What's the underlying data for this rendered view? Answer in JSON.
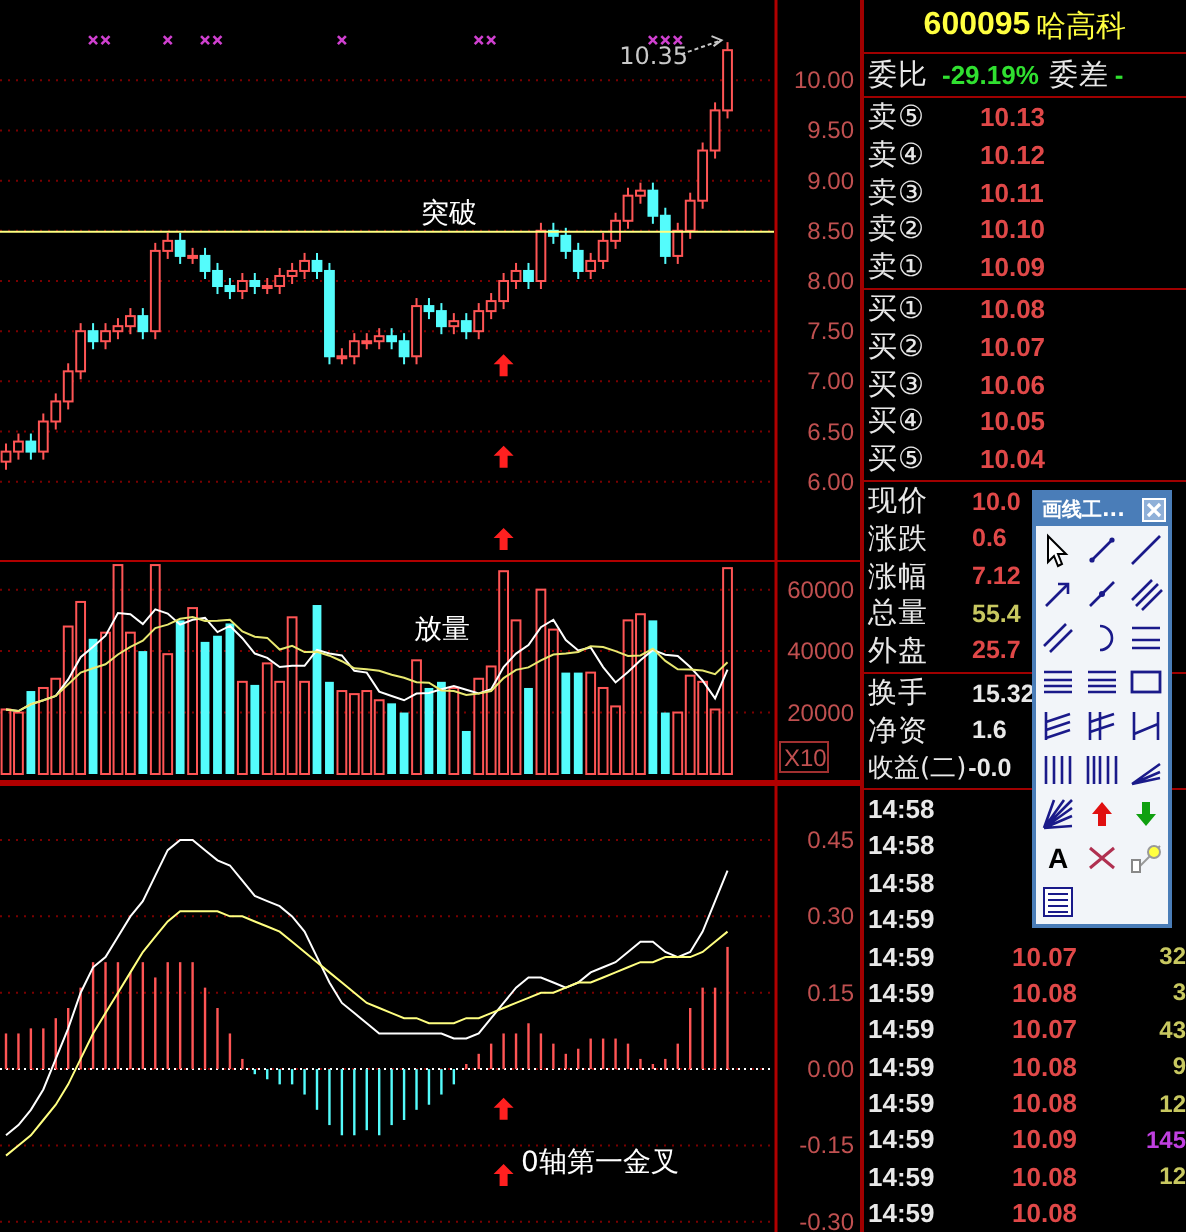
{
  "price_panel": {
    "chart_data": {
      "type": "candlestick",
      "grid": true,
      "ylim": [
        5.2,
        10.8
      ],
      "yticks": [
        {
          "value": 6,
          "label": "6.00"
        },
        {
          "value": 6.5,
          "label": "6.50"
        },
        {
          "value": 7,
          "label": "7.00"
        },
        {
          "value": 7.5,
          "label": "7.50"
        },
        {
          "value": 8,
          "label": "8.00"
        },
        {
          "value": 8.5,
          "label": "8.50"
        },
        {
          "value": 9,
          "label": "9.00"
        },
        {
          "value": 9.5,
          "label": "9.50"
        },
        {
          "value": 10,
          "label": "10.00"
        }
      ],
      "ohlc": [
        [
          6.2,
          6.38,
          6.12,
          6.3
        ],
        [
          6.3,
          6.48,
          6.22,
          6.4
        ],
        [
          6.4,
          6.48,
          6.22,
          6.3
        ],
        [
          6.3,
          6.68,
          6.22,
          6.6
        ],
        [
          6.6,
          6.88,
          6.52,
          6.8
        ],
        [
          6.8,
          7.18,
          6.72,
          7.1
        ],
        [
          7.1,
          7.58,
          7.02,
          7.5
        ],
        [
          7.5,
          7.58,
          7.32,
          7.4
        ],
        [
          7.4,
          7.58,
          7.32,
          7.5
        ],
        [
          7.5,
          7.63,
          7.42,
          7.55
        ],
        [
          7.55,
          7.73,
          7.47,
          7.65
        ],
        [
          7.65,
          7.73,
          7.42,
          7.5
        ],
        [
          7.5,
          8.38,
          7.42,
          8.3
        ],
        [
          8.3,
          8.48,
          8.22,
          8.4
        ],
        [
          8.4,
          8.48,
          8.17,
          8.25
        ],
        [
          8.25,
          8.33,
          8.17,
          8.25
        ],
        [
          8.25,
          8.33,
          8.02,
          8.1
        ],
        [
          8.1,
          8.18,
          7.87,
          7.95
        ],
        [
          7.95,
          8.03,
          7.82,
          7.9
        ],
        [
          7.9,
          8.08,
          7.82,
          8.0
        ],
        [
          8.0,
          8.08,
          7.87,
          7.95
        ],
        [
          7.95,
          8.03,
          7.87,
          7.95
        ],
        [
          7.95,
          8.13,
          7.87,
          8.05
        ],
        [
          8.05,
          8.18,
          7.97,
          8.1
        ],
        [
          8.1,
          8.28,
          8.02,
          8.2
        ],
        [
          8.2,
          8.28,
          8.02,
          8.1
        ],
        [
          8.1,
          8.18,
          7.17,
          7.25
        ],
        [
          7.25,
          7.33,
          7.17,
          7.25
        ],
        [
          7.25,
          7.48,
          7.17,
          7.4
        ],
        [
          7.4,
          7.48,
          7.32,
          7.4
        ],
        [
          7.4,
          7.53,
          7.32,
          7.45
        ],
        [
          7.45,
          7.53,
          7.32,
          7.4
        ],
        [
          7.4,
          7.48,
          7.17,
          7.25
        ],
        [
          7.25,
          7.83,
          7.17,
          7.75
        ],
        [
          7.75,
          7.83,
          7.62,
          7.7
        ],
        [
          7.7,
          7.78,
          7.47,
          7.55
        ],
        [
          7.55,
          7.68,
          7.47,
          7.6
        ],
        [
          7.6,
          7.68,
          7.42,
          7.5
        ],
        [
          7.5,
          7.78,
          7.42,
          7.7
        ],
        [
          7.7,
          7.88,
          7.62,
          7.8
        ],
        [
          7.8,
          8.08,
          7.72,
          8.0
        ],
        [
          8.0,
          8.18,
          7.92,
          8.1
        ],
        [
          8.1,
          8.18,
          7.92,
          8.0
        ],
        [
          8.0,
          8.58,
          7.92,
          8.5
        ],
        [
          8.5,
          8.58,
          8.37,
          8.45
        ],
        [
          8.45,
          8.53,
          8.22,
          8.3
        ],
        [
          8.3,
          8.38,
          8.02,
          8.1
        ],
        [
          8.1,
          8.28,
          8.02,
          8.2
        ],
        [
          8.2,
          8.48,
          8.12,
          8.4
        ],
        [
          8.4,
          8.68,
          8.32,
          8.6
        ],
        [
          8.6,
          8.93,
          8.52,
          8.85
        ],
        [
          8.85,
          8.98,
          8.77,
          8.9
        ],
        [
          8.9,
          8.98,
          8.57,
          8.65
        ],
        [
          8.65,
          8.73,
          8.17,
          8.25
        ],
        [
          8.25,
          8.58,
          8.17,
          8.5
        ],
        [
          8.5,
          8.88,
          8.42,
          8.8
        ],
        [
          8.8,
          9.38,
          8.72,
          9.3
        ],
        [
          9.3,
          9.78,
          9.22,
          9.7
        ],
        [
          9.7,
          10.38,
          9.62,
          10.3
        ]
      ],
      "ref_lines": [
        {
          "axis": "y",
          "value": 8.49,
          "color": "#ffff80"
        }
      ],
      "annotations": [
        "突破",
        "10.35"
      ]
    }
  },
  "volume_panel": {
    "multiplier": "X10",
    "chart_data": {
      "type": "bar",
      "grid": true,
      "stacked": true,
      "ylim": [
        0,
        69000
      ],
      "yticks": [
        20000,
        40000,
        60000
      ],
      "series": [
        {
          "color": "#ff5555",
          "values": [
            21000,
            20000,
            null,
            28000,
            31000,
            48000,
            56000,
            null,
            46000,
            68000,
            46000,
            null,
            68000,
            39000,
            null,
            54000,
            null,
            null,
            null,
            30000,
            null,
            36000,
            30000,
            51000,
            30000,
            null,
            null,
            27000,
            26000,
            27000,
            24000,
            null,
            null,
            37000,
            null,
            null,
            28000,
            null,
            31000,
            35000,
            66000,
            50000,
            null,
            60000,
            47000,
            null,
            null,
            33000,
            28000,
            22000,
            50000,
            52000,
            null,
            null,
            20000,
            32000,
            30000,
            21000,
            67000
          ]
        },
        {
          "color": "#54fcfc",
          "values": [
            null,
            null,
            27000,
            null,
            null,
            null,
            null,
            44000,
            null,
            null,
            null,
            40000,
            null,
            null,
            50000,
            null,
            43000,
            45000,
            49000,
            null,
            29000,
            null,
            null,
            null,
            null,
            55000,
            30000,
            null,
            null,
            null,
            null,
            23000,
            20000,
            null,
            28000,
            30000,
            null,
            14000,
            null,
            null,
            null,
            null,
            28000,
            null,
            null,
            33000,
            33000,
            null,
            null,
            null,
            null,
            null,
            50000,
            20000,
            null,
            null,
            null,
            null,
            null
          ]
        },
        {
          "type": "line",
          "color": "#ffffff",
          "values": [
            21000,
            20500,
            22700,
            24000,
            25400,
            30800,
            38000,
            41400,
            45000,
            52400,
            52000,
            48800,
            53600,
            52200,
            48600,
            50200,
            50800,
            46200,
            48200,
            44200,
            39200,
            37800,
            34800,
            35200,
            35200,
            40400,
            39200,
            38600,
            33600,
            33000,
            26800,
            25400,
            24000,
            26200,
            26400,
            27600,
            28600,
            27400,
            26200,
            27600,
            34800,
            39200,
            42000,
            47800,
            50200,
            43600,
            40200,
            41200,
            34800,
            29800,
            33200,
            37000,
            40400,
            38800,
            38400,
            34800,
            30400,
            24600,
            34000
          ]
        },
        {
          "type": "line",
          "color": "#e8e870",
          "values": [
            21000,
            20500,
            22700,
            24000,
            25400,
            29200,
            33000,
            34400,
            35700,
            38900,
            41400,
            43400,
            47500,
            48600,
            50500,
            51100,
            49800,
            49900,
            50200,
            46400,
            44700,
            44300,
            40500,
            41700,
            39700,
            39800,
            38500,
            36700,
            34400,
            34100,
            33600,
            32300,
            31300,
            29900,
            29700,
            27200,
            27000,
            25700,
            26200,
            27000,
            31200,
            33900,
            34700,
            37000,
            38900,
            39200,
            39700,
            41600,
            41300,
            40000,
            38400,
            38600,
            40800,
            36800,
            34100,
            34000,
            33700,
            32500,
            36400
          ]
        }
      ],
      "annotations": [
        "放量"
      ]
    }
  },
  "macd_panel": {
    "chart_data": {
      "type": "bar",
      "grid": true,
      "ylim": [
        -0.32,
        0.56
      ],
      "yticks": [
        {
          "value": -0.3,
          "label": "-0.30"
        },
        {
          "value": -0.15,
          "label": "-0.15"
        },
        {
          "value": 0,
          "label": "0.00"
        },
        {
          "value": 0.15,
          "label": "0.15"
        },
        {
          "value": 0.3,
          "label": "0.30"
        },
        {
          "value": 0.45,
          "label": "0.45"
        }
      ],
      "series": [
        {
          "color": "#ff5555",
          "values": [
            0.07,
            0.07,
            0.08,
            0.08,
            0.1,
            0.12,
            0.16,
            0.21,
            0.21,
            0.21,
            0.19,
            0.21,
            0.18,
            0.21,
            0.21,
            0.21,
            0.16,
            0.12,
            0.07,
            0.02,
            null,
            null,
            null,
            null,
            null,
            null,
            null,
            null,
            null,
            null,
            null,
            null,
            null,
            null,
            null,
            null,
            null,
            0.01,
            0.03,
            0.05,
            0.07,
            0.07,
            0.09,
            0.07,
            0.05,
            0.03,
            0.04,
            0.06,
            0.06,
            0.06,
            0.05,
            0.02,
            0.01,
            0.02,
            0.05,
            0.12,
            0.16,
            0.16,
            0.24
          ]
        },
        {
          "color": "#54fcfc",
          "values": [
            null,
            null,
            null,
            null,
            null,
            null,
            null,
            null,
            null,
            null,
            null,
            null,
            null,
            null,
            null,
            null,
            null,
            null,
            null,
            null,
            -0.01,
            -0.02,
            -0.03,
            -0.03,
            -0.05,
            -0.08,
            -0.11,
            -0.13,
            -0.13,
            -0.12,
            -0.13,
            -0.11,
            -0.1,
            -0.08,
            -0.07,
            -0.05,
            -0.03,
            null,
            null,
            null,
            null,
            null,
            null,
            null,
            null,
            null,
            null,
            null,
            null,
            null,
            null,
            null,
            null,
            null,
            null,
            null,
            null,
            null,
            null
          ]
        },
        {
          "type": "line",
          "color": "#ffffff",
          "values": [
            -0.13,
            -0.11,
            -0.08,
            -0.04,
            0.02,
            0.08,
            0.15,
            0.2,
            0.22,
            0.26,
            0.3,
            0.33,
            0.38,
            0.43,
            0.45,
            0.45,
            0.43,
            0.41,
            0.4,
            0.37,
            0.34,
            0.33,
            0.32,
            0.3,
            0.27,
            0.22,
            0.17,
            0.13,
            0.11,
            0.09,
            0.07,
            0.07,
            0.07,
            0.07,
            0.07,
            0.07,
            0.06,
            0.06,
            0.07,
            0.1,
            0.13,
            0.16,
            0.18,
            0.18,
            0.17,
            0.16,
            0.17,
            0.19,
            0.2,
            0.21,
            0.23,
            0.25,
            0.25,
            0.23,
            0.22,
            0.23,
            0.27,
            0.33,
            0.39
          ]
        },
        {
          "type": "line",
          "color": "#ffff80",
          "values": [
            -0.17,
            -0.15,
            -0.13,
            -0.1,
            -0.07,
            -0.03,
            0.02,
            0.07,
            0.11,
            0.15,
            0.19,
            0.23,
            0.26,
            0.29,
            0.31,
            0.31,
            0.31,
            0.31,
            0.3,
            0.3,
            0.29,
            0.28,
            0.27,
            0.25,
            0.23,
            0.21,
            0.19,
            0.17,
            0.15,
            0.13,
            0.12,
            0.11,
            0.1,
            0.1,
            0.09,
            0.09,
            0.09,
            0.1,
            0.1,
            0.11,
            0.12,
            0.13,
            0.14,
            0.15,
            0.15,
            0.16,
            0.17,
            0.17,
            0.18,
            0.19,
            0.2,
            0.21,
            0.21,
            0.22,
            0.22,
            0.22,
            0.23,
            0.25,
            0.27
          ]
        }
      ],
      "ref_lines": [
        {
          "axis": "y",
          "value": 0,
          "color": "#ffffff"
        }
      ],
      "annotations": [
        "0轴第一金叉"
      ]
    }
  },
  "quote": {
    "code": "600095",
    "name": "哈高科",
    "ratio": {
      "label": "委比",
      "value": "-29.19%"
    },
    "diff": {
      "label": "委差",
      "value": "-"
    },
    "asks": [
      {
        "label": "卖⑤",
        "price": "10.13"
      },
      {
        "label": "卖④",
        "price": "10.12"
      },
      {
        "label": "卖③",
        "price": "10.11"
      },
      {
        "label": "卖②",
        "price": "10.10"
      },
      {
        "label": "卖①",
        "price": "10.09"
      }
    ],
    "bids": [
      {
        "label": "买①",
        "price": "10.08"
      },
      {
        "label": "买②",
        "price": "10.07"
      },
      {
        "label": "买③",
        "price": "10.06"
      },
      {
        "label": "买④",
        "price": "10.05"
      },
      {
        "label": "买⑤",
        "price": "10.04"
      }
    ],
    "stats": [
      {
        "label": "现价",
        "value": "10.0",
        "color": "#e04848"
      },
      {
        "label": "涨跌",
        "value": "0.6",
        "color": "#e04848"
      },
      {
        "label": "涨幅",
        "value": "7.12",
        "color": "#e04848"
      },
      {
        "label": "总量",
        "value": "55.4",
        "color": "#c8c860"
      },
      {
        "label": "外盘",
        "value": "25.7",
        "color": "#e04848"
      }
    ],
    "extra": [
      {
        "label": "换手",
        "value": "15.32"
      },
      {
        "label": "净资",
        "value": "1.6"
      },
      {
        "label": "收益(二)",
        "value": "-0.0"
      }
    ],
    "trades": [
      {
        "time": "14:58"
      },
      {
        "time": "14:58"
      },
      {
        "time": "14:58"
      },
      {
        "time": "14:59"
      },
      {
        "time": "14:59",
        "price": "10.07",
        "volume": "32",
        "color": "#c8c860"
      },
      {
        "time": "14:59",
        "price": "10.08",
        "volume": "3",
        "color": "#c8c860"
      },
      {
        "time": "14:59",
        "price": "10.07",
        "volume": "43",
        "color": "#c8c860"
      },
      {
        "time": "14:59",
        "price": "10.08",
        "volume": "9",
        "color": "#c8c860"
      },
      {
        "time": "14:59",
        "price": "10.08",
        "volume": "12",
        "color": "#c8c860"
      },
      {
        "time": "14:59",
        "price": "10.09",
        "volume": "145",
        "color": "#c040e0"
      },
      {
        "time": "14:59",
        "price": "10.08",
        "volume": "12",
        "color": "#c8c860"
      },
      {
        "time": "14:59",
        "price": "10.08"
      }
    ]
  },
  "toolbox": {
    "title": "画线工...",
    "text_tool": "A"
  }
}
